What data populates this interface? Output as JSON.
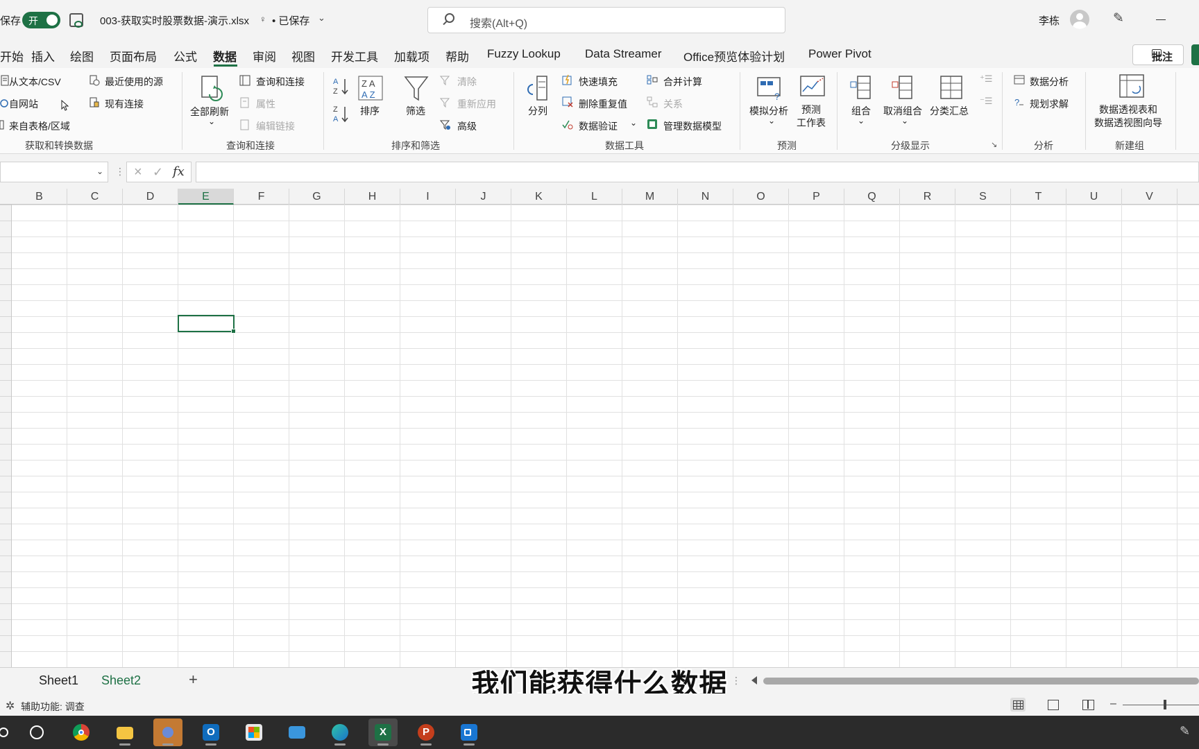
{
  "titlebar": {
    "autosave_label": "保存",
    "autosave_state": "开",
    "filename": "003-获取实时股票数据-演示.xlsx",
    "save_state": "• 已保存",
    "search_placeholder": "搜索(Alt+Q)",
    "username": "李栋"
  },
  "menu": {
    "items": [
      "开始",
      "插入",
      "绘图",
      "页面布局",
      "公式",
      "数据",
      "审阅",
      "视图",
      "开发工具",
      "加载项",
      "帮助",
      "Fuzzy Lookup",
      "Data Streamer",
      "Office预览体验计划",
      "Power Pivot"
    ],
    "active": "数据",
    "comment_label": "批注"
  },
  "ribbon": {
    "get_data": {
      "from_text_csv": "从文本/CSV",
      "from_web": "自网站",
      "from_table": "来自表格/区域",
      "recent_sources": "最近使用的源",
      "existing_connections": "现有连接",
      "label": "获取和转换数据"
    },
    "queries": {
      "refresh_all": "全部刷新",
      "queries_connections": "查询和连接",
      "properties": "属性",
      "edit_links": "编辑链接",
      "label": "查询和连接"
    },
    "sort_filter": {
      "sort": "排序",
      "filter": "筛选",
      "clear": "清除",
      "reapply": "重新应用",
      "advanced": "高级",
      "label": "排序和筛选"
    },
    "data_tools": {
      "text_to_columns": "分列",
      "flash_fill": "快速填充",
      "remove_duplicates": "删除重复值",
      "data_validation": "数据验证",
      "consolidate": "合并计算",
      "relationships": "关系",
      "manage_model": "管理数据模型",
      "label": "数据工具"
    },
    "forecast": {
      "what_if": "模拟分析",
      "forecast_sheet_1": "预测",
      "forecast_sheet_2": "工作表",
      "label": "预测"
    },
    "outline": {
      "group": "组合",
      "ungroup": "取消组合",
      "subtotal": "分类汇总",
      "label": "分级显示"
    },
    "analysis": {
      "data_analysis": "数据分析",
      "solver": "规划求解",
      "label": "分析"
    },
    "new_group": {
      "pivot_wizard_1": "数据透视表和",
      "pivot_wizard_2": "数据透视图向导",
      "label": "新建组"
    }
  },
  "formula_bar": {
    "fx": "fx",
    "value": ""
  },
  "sheet": {
    "columns": [
      "B",
      "C",
      "D",
      "E",
      "F",
      "G",
      "H",
      "I",
      "J",
      "K",
      "L",
      "M",
      "N",
      "O",
      "P",
      "Q",
      "R",
      "S",
      "T",
      "U",
      "V"
    ],
    "selected_column": "E"
  },
  "tabs": {
    "sheets": [
      "Sheet1",
      "Sheet2"
    ],
    "active": "Sheet2",
    "add": "+"
  },
  "subtitle": "我们能获得什么数据",
  "status": {
    "accessibility": "辅助功能: 调查"
  },
  "colors": {
    "accent": "#1e7145"
  },
  "taskbar": {
    "apps": [
      "windows-icon",
      "cortana-icon",
      "chrome-icon",
      "file-explorer-icon",
      "paint-icon",
      "outlook-icon",
      "store-icon",
      "mail-icon",
      "edge-icon",
      "excel-icon",
      "powerpoint-icon",
      "screen-recorder-icon"
    ]
  }
}
